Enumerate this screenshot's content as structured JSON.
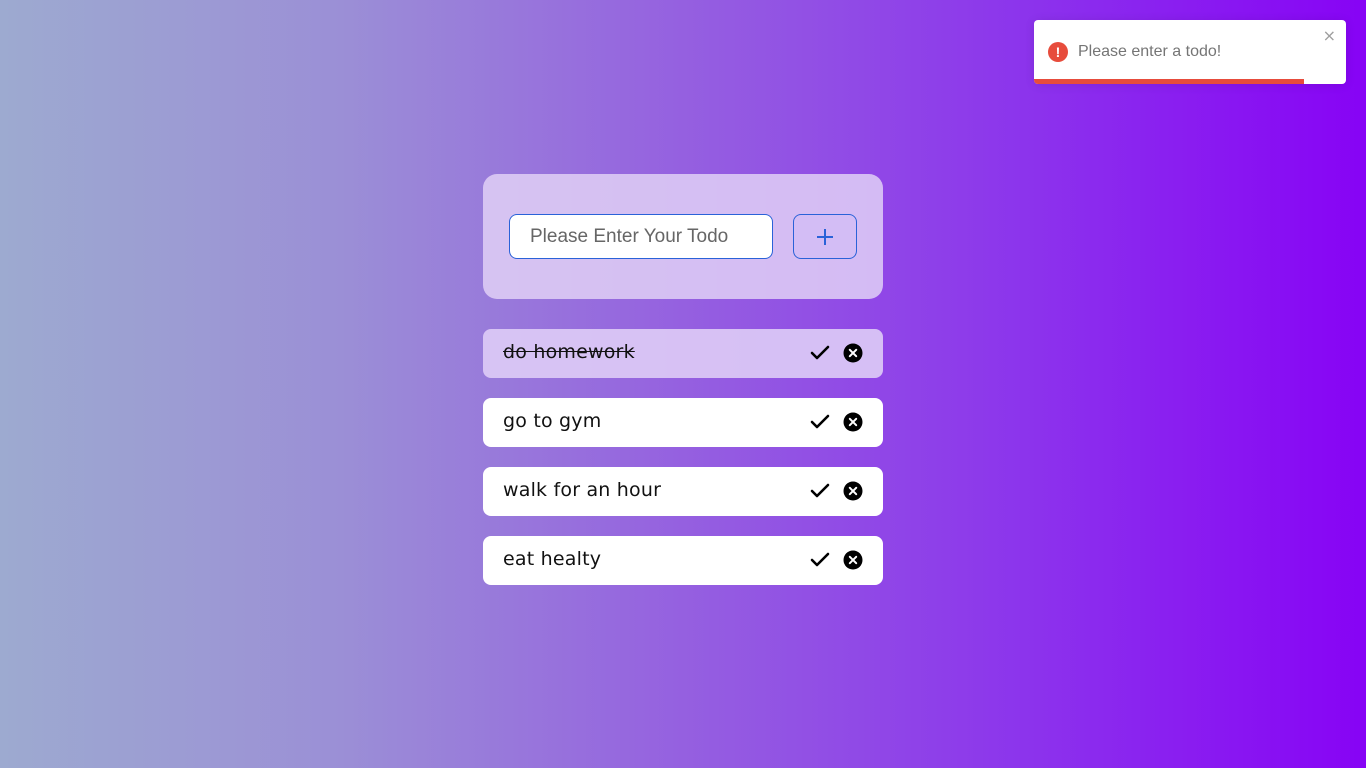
{
  "toast": {
    "message": "Please enter a todo!",
    "icon": "error-icon",
    "icon_glyph": "!",
    "close_glyph": "×",
    "accent": "#e74c3c",
    "progress": 0.865
  },
  "form": {
    "placeholder": "Please Enter Your Todo",
    "value": "",
    "add_icon": "plus-icon",
    "accent": "#2a62d8"
  },
  "todos": [
    {
      "text": "do homework",
      "completed": true
    },
    {
      "text": "go to gym",
      "completed": false
    },
    {
      "text": "walk for an hour",
      "completed": false
    },
    {
      "text": "eat healty",
      "completed": false
    }
  ],
  "icons": {
    "complete": "checkmark-icon",
    "delete": "close-circle-icon"
  }
}
